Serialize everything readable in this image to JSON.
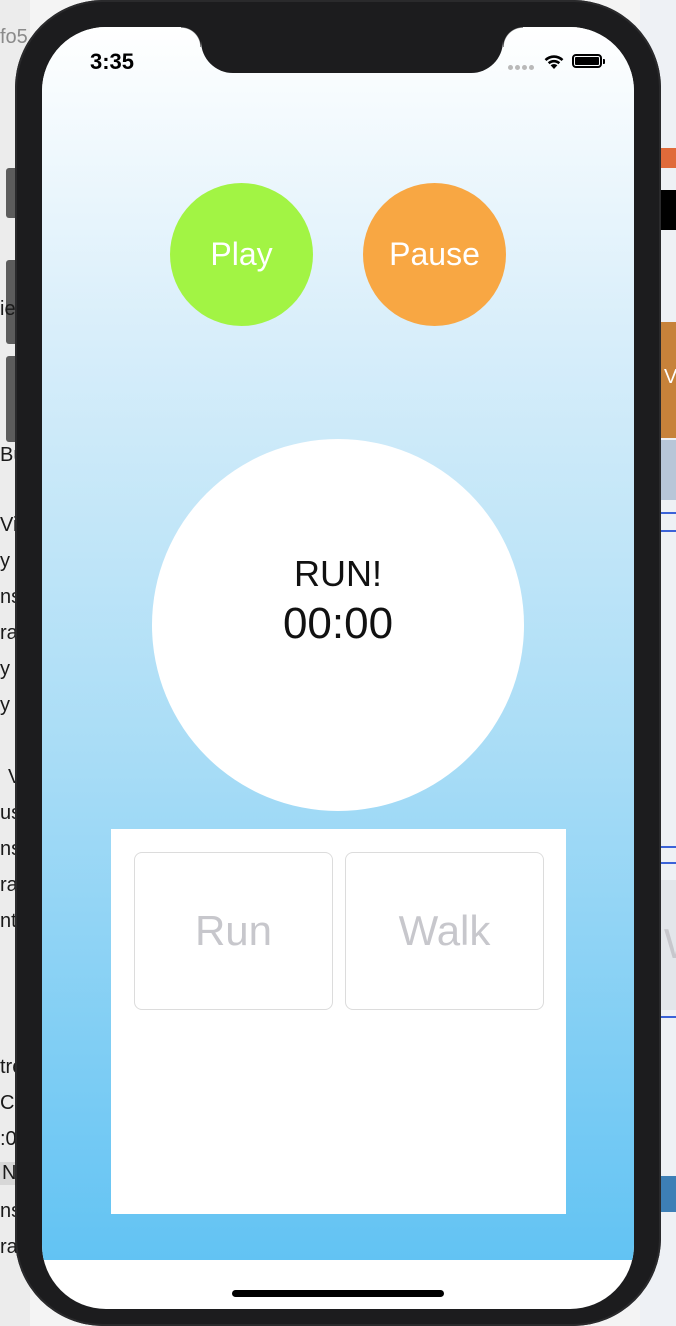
{
  "status_bar": {
    "time": "3:35",
    "signal_icon": "signal-dots-icon",
    "wifi_icon": "wifi-icon",
    "battery_icon": "battery-full-icon"
  },
  "controls": {
    "play_label": "Play",
    "pause_label": "Pause",
    "play_color": "#a2f444",
    "pause_color": "#f8a743"
  },
  "timer": {
    "label": "RUN!",
    "value": "00:00"
  },
  "modes": {
    "run_label": "Run",
    "walk_label": "Walk"
  },
  "background": {
    "gradient_top": "#ffffff",
    "gradient_bottom": "#62c3f3"
  },
  "desktop_fragments": {
    "left": [
      "fo5",
      "ie",
      "Bu",
      "Vie",
      "y",
      "ns",
      "ra",
      "y",
      "y",
      "V",
      "us",
      "ns",
      "ra",
      "nt",
      "tro",
      "Co",
      ":0",
      "N",
      "ns",
      "ra"
    ],
    "right": [
      "Va",
      "W"
    ]
  }
}
